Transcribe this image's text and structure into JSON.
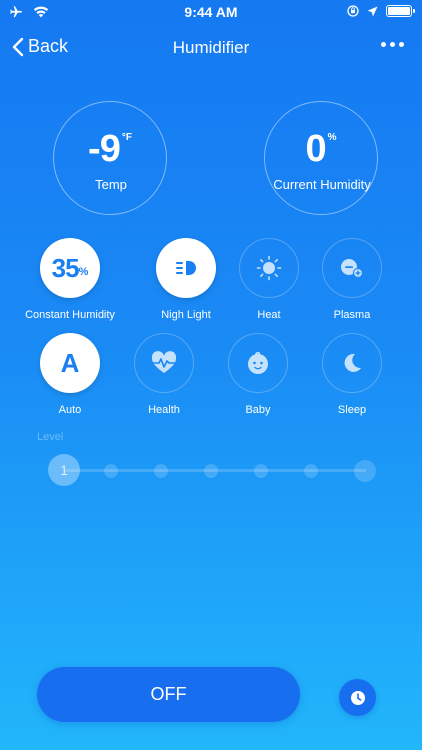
{
  "status_bar": {
    "time": "9:44 AM"
  },
  "nav": {
    "back_label": "Back",
    "title": "Humidifier"
  },
  "temp": {
    "value": "-9",
    "unit": "°F",
    "label": "Temp"
  },
  "humidity": {
    "value": "0",
    "unit": "%",
    "label": "Current Humidity"
  },
  "modes": [
    {
      "label": "Constant Humidity",
      "value": "35",
      "unit": "%",
      "icon": "constant-humidity",
      "active": true
    },
    {
      "label": "Nigh Light",
      "icon": "headlight-icon",
      "active": true
    },
    {
      "label": "Heat",
      "icon": "sun-icon",
      "active": false
    },
    {
      "label": "Plasma",
      "icon": "plasma-icon",
      "active": false
    },
    {
      "label": "Auto",
      "glyph": "A",
      "icon": "auto-icon",
      "active": true
    },
    {
      "label": "Health",
      "icon": "heartbeat-icon",
      "active": false
    },
    {
      "label": "Baby",
      "icon": "baby-face-icon",
      "active": false
    },
    {
      "label": "Sleep",
      "icon": "moon-icon",
      "active": false
    }
  ],
  "level": {
    "label": "Level",
    "value": "1",
    "max_steps": 7
  },
  "power": {
    "label": "OFF"
  },
  "colors": {
    "accent": "#1a7ff3",
    "button": "#176ff0",
    "background_top": "#1579f2",
    "background_bottom": "#22b6fb"
  }
}
